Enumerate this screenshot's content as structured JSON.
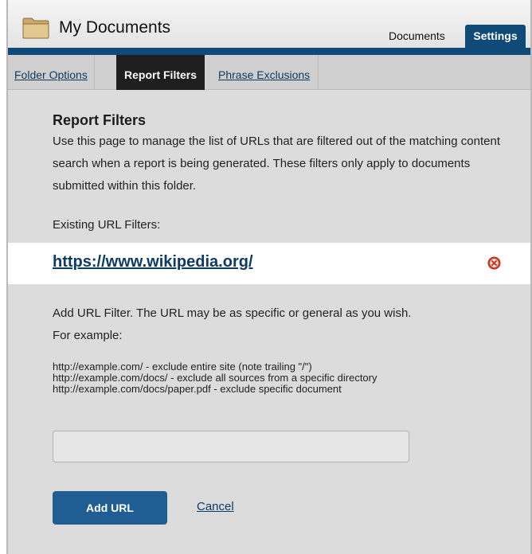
{
  "header": {
    "title": "My Documents",
    "tabs": [
      {
        "label": "Documents",
        "active": false
      },
      {
        "label": "Settings",
        "active": true
      }
    ]
  },
  "subtabs": [
    {
      "label": "Folder Options",
      "active": false
    },
    {
      "label": "Report Filters",
      "active": true
    },
    {
      "label": "Phrase Exclusions",
      "active": false
    }
  ],
  "report_filters": {
    "title": "Report Filters",
    "description": "Use this page to manage the list of URLs that are filtered out of the matching content search when a report is being generated. These filters only apply to documents submitted within this folder.",
    "existing_label": "Existing URL Filters:",
    "filters": [
      {
        "url": "https://www.wikipedia.org/",
        "remove_icon": "remove-circle-icon"
      }
    ],
    "add_help_line1": "Add URL Filter. The URL may be as specific or general as you wish.",
    "add_help_line2": "For example:",
    "examples": [
      "http://example.com/ - exclude entire site (note trailing \"/\")",
      "http://example.com/docs/ - exclude all sources from a specific directory",
      "http://example.com/docs/paper.pdf - exclude specific document"
    ],
    "input_value": "",
    "add_button": "Add URL",
    "cancel_link": "Cancel"
  },
  "colors": {
    "brand_blue": "#0f4a78",
    "button_blue": "#1f5d92",
    "panel_gray": "#dcdcdc",
    "remove_red": "#e0442a"
  }
}
